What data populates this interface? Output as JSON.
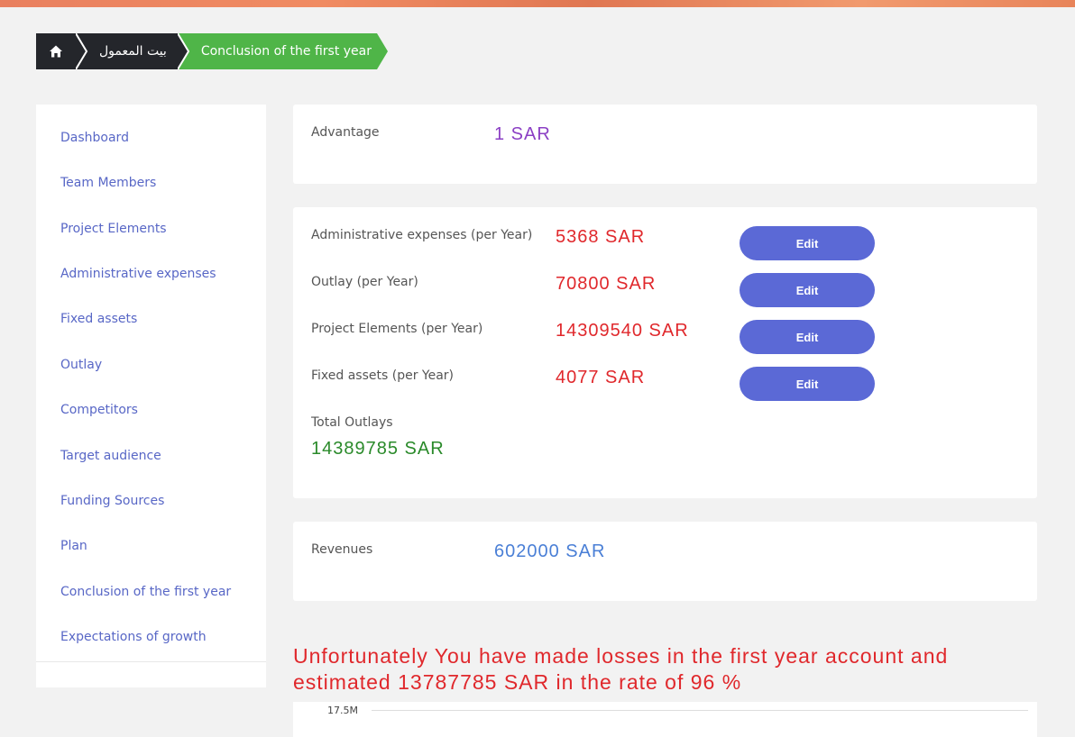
{
  "breadcrumb": {
    "home_icon": "home-icon",
    "parent": "بيت المعمول",
    "current": "Conclusion of the first year"
  },
  "sidebar": {
    "items": [
      {
        "label": "Dashboard"
      },
      {
        "label": "Team Members"
      },
      {
        "label": "Project Elements"
      },
      {
        "label": "Administrative expenses"
      },
      {
        "label": "Fixed assets"
      },
      {
        "label": "Outlay"
      },
      {
        "label": "Competitors"
      },
      {
        "label": "Target audience"
      },
      {
        "label": "Funding Sources"
      },
      {
        "label": "Plan"
      },
      {
        "label": "Conclusion of the first year"
      },
      {
        "label": "Expectations of growth"
      }
    ]
  },
  "advantage": {
    "label": "Advantage",
    "value": "1 SAR"
  },
  "expenses": {
    "rows": [
      {
        "label": "Administrative expenses (per Year)",
        "value": "5368 SAR",
        "button": "Edit"
      },
      {
        "label": "Outlay (per Year)",
        "value": "70800 SAR",
        "button": "Edit"
      },
      {
        "label": "Project Elements (per Year)",
        "value": "14309540 SAR",
        "button": "Edit"
      },
      {
        "label": "Fixed assets (per Year)",
        "value": "4077 SAR",
        "button": "Edit"
      }
    ],
    "total_label": "Total Outlays",
    "total_value": "14389785 SAR"
  },
  "revenues": {
    "label": "Revenues",
    "value": "602000 SAR"
  },
  "loss_message": "Unfortunately You have made losses in the first year account and estimated 13787785 SAR in the rate of 96 %",
  "chart": {
    "tick_label": "17.5M"
  },
  "colors": {
    "advantage": "#8b3fc4",
    "expense_value": "#e0282c",
    "total_value": "#2a8a2a",
    "revenue_value": "#4a7fd6",
    "link": "#5867c6",
    "button": "#5b69d6",
    "breadcrumb_active": "#4fb548"
  }
}
